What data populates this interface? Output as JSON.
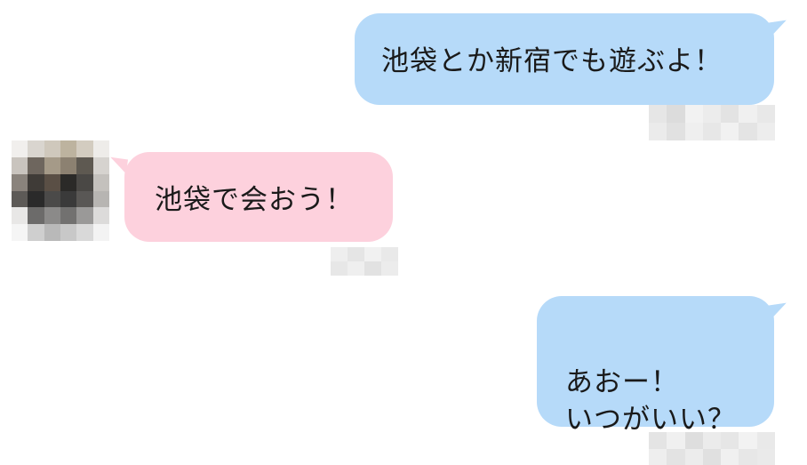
{
  "messages": [
    {
      "id": "msg1",
      "side": "sent",
      "text": "池袋とか新宿でも遊ぶよ！"
    },
    {
      "id": "msg2",
      "side": "received",
      "text": "池袋で会おう！"
    },
    {
      "id": "msg3",
      "side": "sent",
      "text": "あおー！\nいつがいい？"
    }
  ],
  "colors": {
    "sent_bubble": "#b6daf9",
    "received_bubble": "#fdd1dd",
    "text": "#1a1a1a",
    "background": "#ffffff"
  },
  "icons": {
    "avatar": "pixelated-avatar-icon"
  }
}
